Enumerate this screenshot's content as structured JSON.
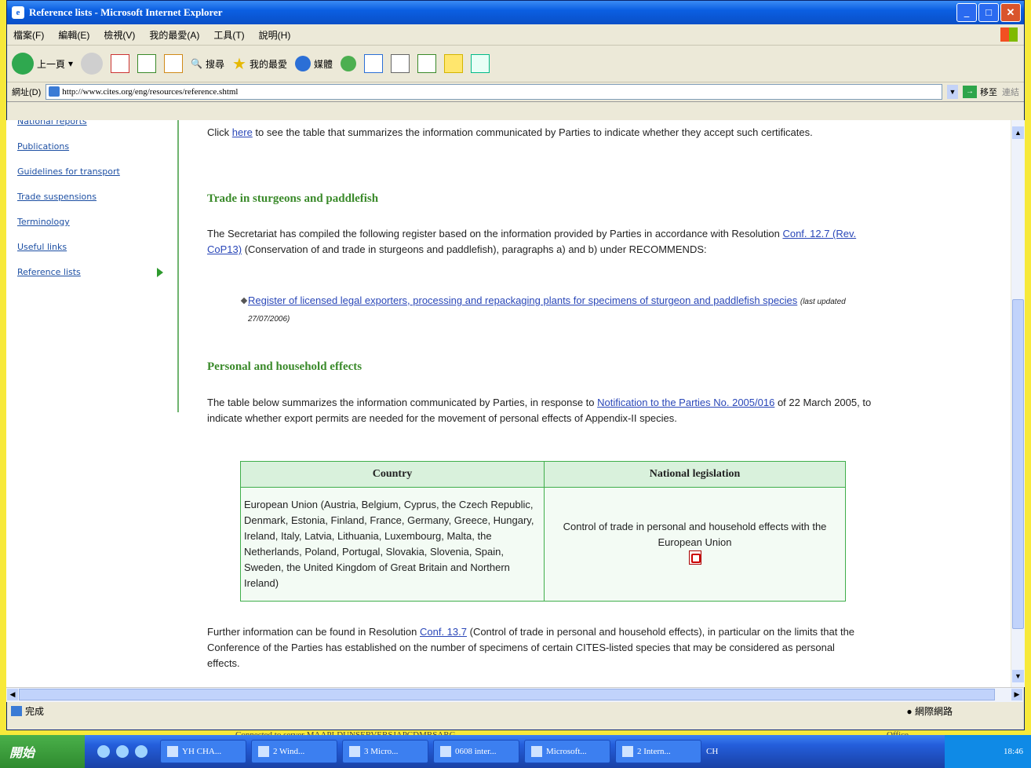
{
  "window": {
    "title": "Reference lists - Microsoft Internet Explorer"
  },
  "menu": [
    "檔案(F)",
    "編輯(E)",
    "檢視(V)",
    "我的最愛(A)",
    "工具(T)",
    "說明(H)"
  ],
  "toolbar": {
    "back": "上一頁",
    "search": "搜尋",
    "favorites": "我的最愛",
    "media": "媒體"
  },
  "address": {
    "label": "網址(D)",
    "url": "http://www.cites.org/eng/resources/reference.shtml",
    "go": "移至",
    "links": "連結"
  },
  "sidebar": {
    "items": [
      "National reports",
      "Publications",
      "Guidelines for transport",
      "Trade suspensions",
      "Terminology",
      "Useful links",
      "Reference lists"
    ]
  },
  "main": {
    "intro_click": "Click ",
    "intro_here": "here",
    "intro_rest": " to see the table that summarizes the information communicated by Parties to indicate whether they accept such certificates.",
    "sturgeon_heading": "Trade in sturgeons and paddlefish",
    "sturgeon_p1": "The Secretariat has compiled the following register based on the information provided by Parties in accordance with Resolution ",
    "sturgeon_link": "Conf. 12.7 (Rev. CoP13)",
    "sturgeon_p2": " (Conservation of and trade in sturgeons and paddlefish), paragraphs a) and b) under RECOMMENDS:",
    "register_link": "Register of licensed legal exporters, processing and repackaging plants for specimens of sturgeon and paddlefish species",
    "register_note": "(last updated 27/07/2006)",
    "personal_heading": "Personal and household effects",
    "personal_p1": "The table below summarizes the information communicated by Parties, in response to ",
    "personal_link": "Notification to the Parties No. 2005/016",
    "personal_p2": " of 22 March 2005, to indicate whether export permits are needed for the movement of personal effects of Appendix-II species.",
    "table": {
      "col_country": "Country",
      "col_legislation": "National legislation",
      "country": "European Union (Austria, Belgium, Cyprus, the Czech Republic, Denmark, Estonia, Finland, France, Germany, Greece, Hungary, Ireland, Italy, Latvia, Lithuania, Luxembourg, Malta, the Netherlands, Poland, Portugal, Slovakia, Slovenia, Spain, Sweden, the United Kingdom of Great Britain and Northern Ireland)",
      "legislation": "Control of trade in personal and household effects with the European Union"
    },
    "further_p1": "Further information can be found in Resolution ",
    "further_link": "Conf. 13.7",
    "further_p2": " (Control of trade in personal and household effects), in particular on the limits that the Conference of the Parties has established on the number of specimens of certain CITES-listed species that may be considered as personal effects."
  },
  "status": {
    "done": "完成",
    "zone": "網際網路"
  },
  "behind_text": "Connected to server MAAPLDUNSERVERSJAPCDMRSARG",
  "behind_right": "Office",
  "taskbar": {
    "start": "開始",
    "tasks": [
      "YH CHA...",
      "2 Wind...",
      "3 Micro...",
      "0608 inter...",
      "Microsoft...",
      "2 Intern..."
    ],
    "lang": "CH",
    "clock": "18:46"
  }
}
